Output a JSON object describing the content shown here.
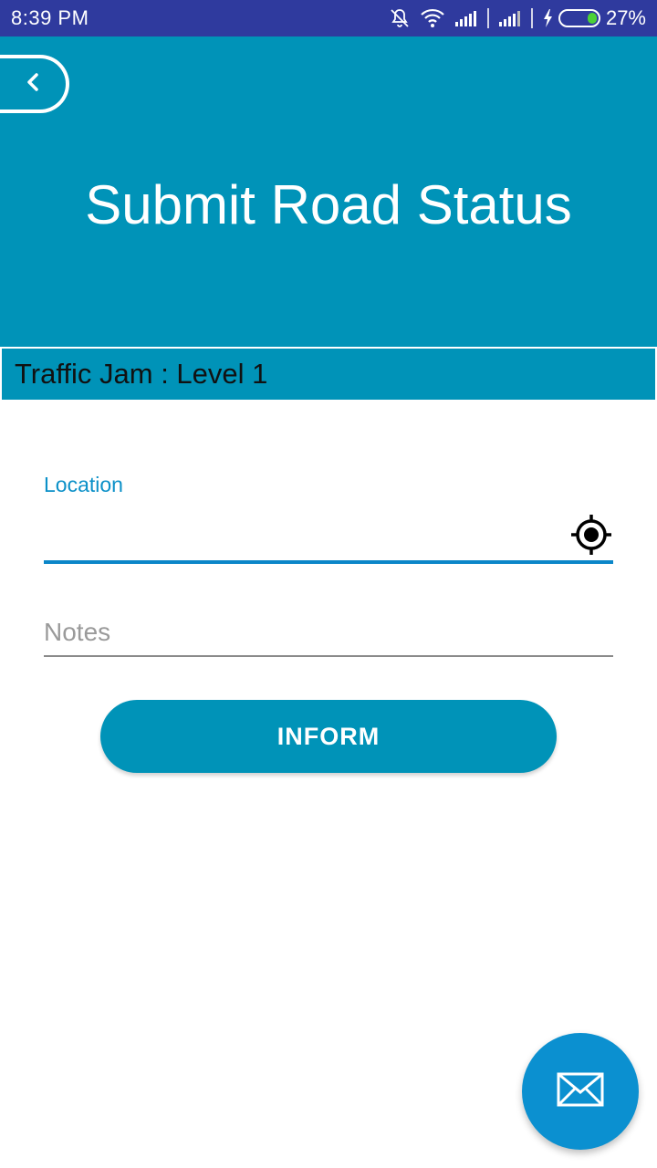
{
  "status_bar": {
    "time": "8:39  PM",
    "battery_percent": "27%",
    "battery_level": 0.27,
    "icons": [
      "notifications-off-icon",
      "wifi-icon",
      "signal-icon",
      "signal-icon",
      "charging-icon",
      "battery-icon"
    ]
  },
  "header": {
    "back_icon": "chevron-left-icon",
    "title": "Submit Road Status",
    "background_color": "#0093b8"
  },
  "status_type": {
    "text": "Traffic Jam : Level 1"
  },
  "form": {
    "location_label": "Location",
    "location_value": "",
    "location_icon": "my-location-icon",
    "notes_placeholder": "Notes",
    "notes_value": "",
    "submit_label": "INFORM"
  },
  "fab": {
    "icon": "mail-icon",
    "color": "#0b90d0"
  },
  "colors": {
    "status_bar": "#2f3a9e",
    "accent": "#0b86c8",
    "primary": "#0093b8"
  }
}
